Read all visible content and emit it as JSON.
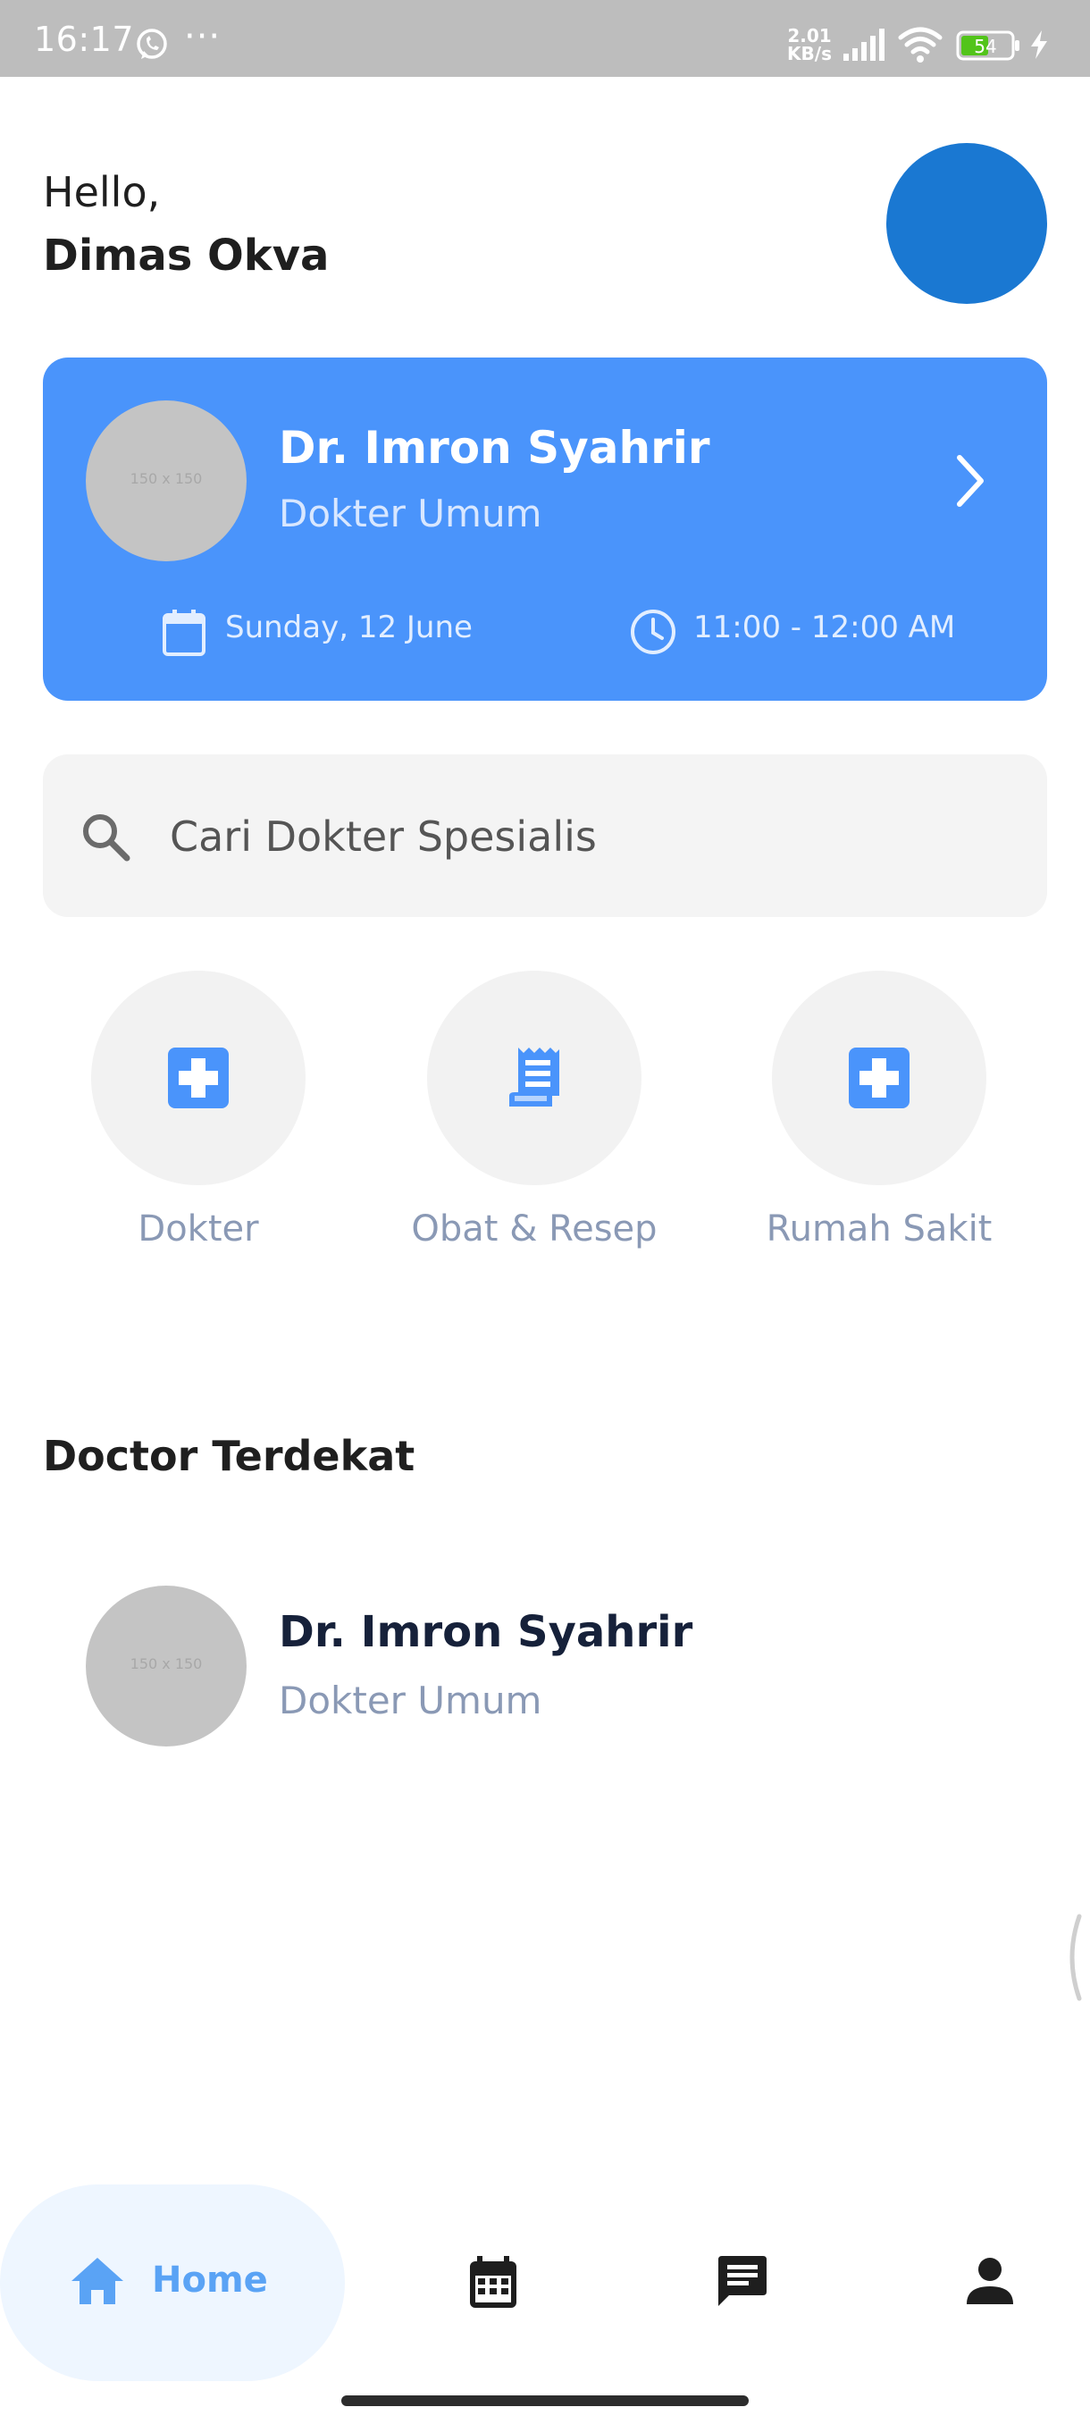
{
  "status_bar": {
    "time": "16:17",
    "more": "···",
    "net_speed_value": "2.01",
    "net_speed_unit": "KB/s",
    "battery": "54"
  },
  "greeting": {
    "hello": "Hello,",
    "name": "Dimas Okva"
  },
  "appointment": {
    "photo_placeholder": "150 x 150",
    "doctor_name": "Dr. Imron Syahrir",
    "specialty": "Dokter Umum",
    "date": "Sunday, 12 June",
    "time": "11:00 - 12:00 AM"
  },
  "search": {
    "placeholder": "Cari Dokter Spesialis"
  },
  "categories": [
    {
      "label": "Dokter",
      "icon": "medical-cross-icon"
    },
    {
      "label": "Obat & Resep",
      "icon": "receipt-icon"
    },
    {
      "label": "Rumah Sakit",
      "icon": "medical-cross-icon"
    }
  ],
  "nearest": {
    "title": "Doctor Terdekat",
    "doctors": [
      {
        "photo_placeholder": "150 x 150",
        "name": "Dr. Imron Syahrir",
        "specialty": "Dokter Umum"
      }
    ]
  },
  "nav": {
    "home_label": "Home",
    "items": [
      "home-icon",
      "calendar-icon",
      "chat-icon",
      "person-icon"
    ]
  },
  "colors": {
    "primary": "#4a94fb",
    "avatar": "#1a78d2",
    "accent_text": "#5aa3f5",
    "muted_text": "#8a99b5"
  }
}
